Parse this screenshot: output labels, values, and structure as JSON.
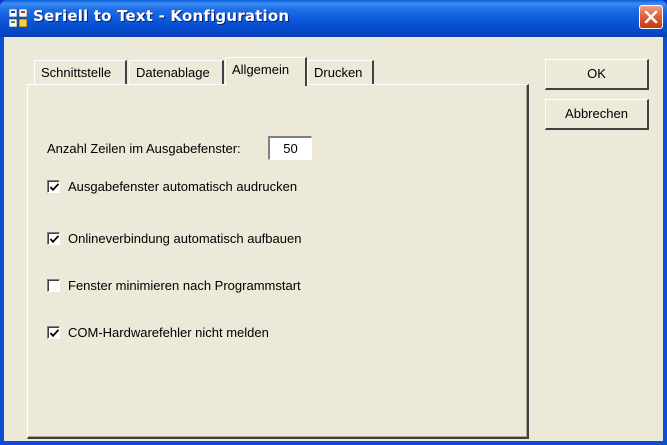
{
  "window": {
    "title": "Seriell to Text - Konfiguration"
  },
  "tabs": [
    {
      "label": "Schnittstelle"
    },
    {
      "label": "Datenablage"
    },
    {
      "label": "Allgemein",
      "active": true
    },
    {
      "label": "Drucken"
    }
  ],
  "general": {
    "lines_label": "Anzahl Zeilen im Ausgabefenster:",
    "lines_value": "50",
    "options": [
      {
        "label": "Ausgabefenster automatisch audrucken",
        "checked": true
      },
      {
        "label": "Onlineverbindung automatisch aufbauen",
        "checked": true
      },
      {
        "label": "Fenster minimieren nach Programmstart",
        "checked": false
      },
      {
        "label": "COM-Hardwarefehler nicht melden",
        "checked": true
      }
    ]
  },
  "buttons": {
    "ok": "OK",
    "cancel": "Abbrechen"
  },
  "colors": {
    "titlebar": "#0a54d8",
    "dialog_bg": "#ece9d8",
    "close_button": "#e0613a"
  },
  "icons": {
    "app": "app-icon",
    "close": "close-icon",
    "check": "checkmark-icon"
  }
}
